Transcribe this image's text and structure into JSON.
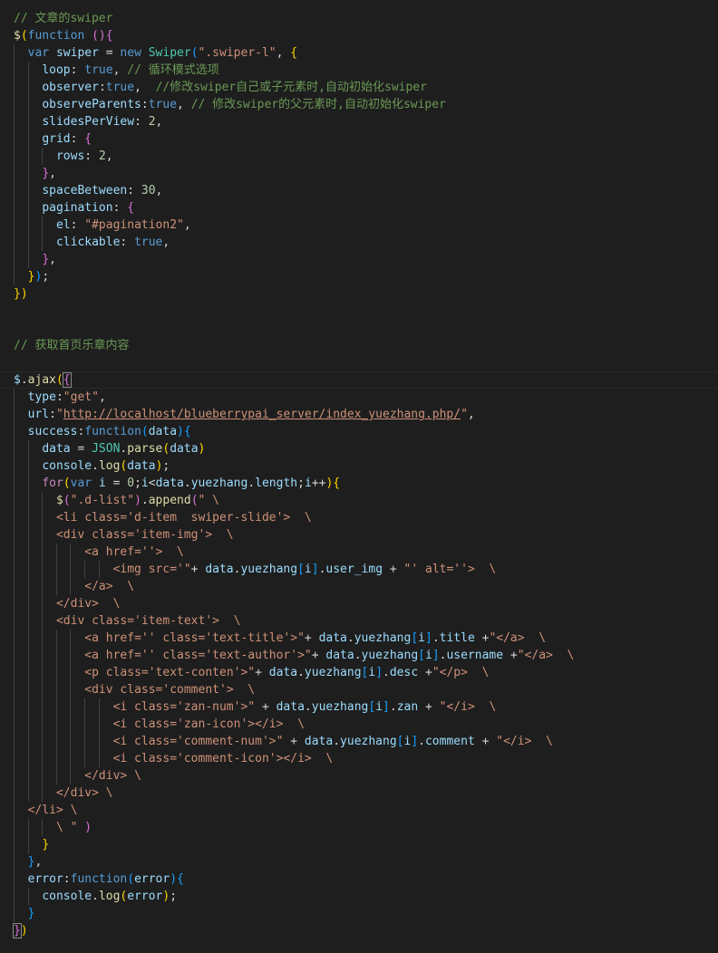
{
  "editor": {
    "theme": {
      "background": "#1e1e1e",
      "comment": "#6a9955",
      "keyword": "#569cd6",
      "variable": "#9cdcfe",
      "function": "#dcdcaa",
      "string": "#ce9178",
      "number": "#b5cea8",
      "class": "#4ec9b0",
      "bracket_colors": [
        "#ffd700",
        "#da70d6",
        "#179fff"
      ]
    },
    "lines": [
      {
        "indent": 0,
        "tokens": [
          [
            "cm",
            "// 文章的swiper"
          ]
        ]
      },
      {
        "indent": 0,
        "tokens": [
          [
            "fn",
            "$"
          ],
          [
            "b1",
            "("
          ],
          [
            "kw",
            "function"
          ],
          [
            "plain",
            " "
          ],
          [
            "b2",
            "()"
          ],
          [
            "b2",
            "{"
          ]
        ]
      },
      {
        "indent": 1,
        "tokens": [
          [
            "kw",
            "var"
          ],
          [
            "plain",
            " "
          ],
          [
            "var",
            "swiper"
          ],
          [
            "plain",
            " = "
          ],
          [
            "kw",
            "new"
          ],
          [
            "plain",
            " "
          ],
          [
            "cls",
            "Swiper"
          ],
          [
            "b3",
            "("
          ],
          [
            "str",
            "\".swiper-l\""
          ],
          [
            "plain",
            ", "
          ],
          [
            "b1",
            "{"
          ]
        ]
      },
      {
        "indent": 2,
        "tokens": [
          [
            "var",
            "loop"
          ],
          [
            "plain",
            ": "
          ],
          [
            "kw",
            "true"
          ],
          [
            "plain",
            ", "
          ],
          [
            "cm",
            "// 循环模式选项"
          ]
        ]
      },
      {
        "indent": 2,
        "tokens": [
          [
            "var",
            "observer"
          ],
          [
            "plain",
            ":"
          ],
          [
            "kw",
            "true"
          ],
          [
            "plain",
            ",  "
          ],
          [
            "cm",
            "//修改swiper自己或子元素时,自动初始化swiper"
          ]
        ]
      },
      {
        "indent": 2,
        "tokens": [
          [
            "var",
            "observeParents"
          ],
          [
            "plain",
            ":"
          ],
          [
            "kw",
            "true"
          ],
          [
            "plain",
            ", "
          ],
          [
            "cm",
            "// 修改swiper的父元素时,自动初始化swiper"
          ]
        ]
      },
      {
        "indent": 2,
        "tokens": [
          [
            "var",
            "slidesPerView"
          ],
          [
            "plain",
            ": "
          ],
          [
            "num",
            "2"
          ],
          [
            "plain",
            ","
          ]
        ]
      },
      {
        "indent": 2,
        "tokens": [
          [
            "var",
            "grid"
          ],
          [
            "plain",
            ": "
          ],
          [
            "b2",
            "{"
          ]
        ]
      },
      {
        "indent": 3,
        "tokens": [
          [
            "var",
            "rows"
          ],
          [
            "plain",
            ": "
          ],
          [
            "num",
            "2"
          ],
          [
            "plain",
            ","
          ]
        ]
      },
      {
        "indent": 2,
        "tokens": [
          [
            "b2",
            "}"
          ],
          [
            "plain",
            ","
          ]
        ]
      },
      {
        "indent": 2,
        "tokens": [
          [
            "var",
            "spaceBetween"
          ],
          [
            "plain",
            ": "
          ],
          [
            "num",
            "30"
          ],
          [
            "plain",
            ","
          ]
        ]
      },
      {
        "indent": 2,
        "tokens": [
          [
            "var",
            "pagination"
          ],
          [
            "plain",
            ": "
          ],
          [
            "b2",
            "{"
          ]
        ]
      },
      {
        "indent": 3,
        "tokens": [
          [
            "var",
            "el"
          ],
          [
            "plain",
            ": "
          ],
          [
            "str",
            "\"#pagination2\""
          ],
          [
            "plain",
            ","
          ]
        ]
      },
      {
        "indent": 3,
        "tokens": [
          [
            "var",
            "clickable"
          ],
          [
            "plain",
            ": "
          ],
          [
            "kw",
            "true"
          ],
          [
            "plain",
            ","
          ]
        ]
      },
      {
        "indent": 2,
        "tokens": [
          [
            "b2",
            "}"
          ],
          [
            "plain",
            ","
          ]
        ]
      },
      {
        "indent": 1,
        "tokens": [
          [
            "b1",
            "}"
          ],
          [
            "b3",
            ")"
          ],
          [
            "plain",
            ";"
          ]
        ]
      },
      {
        "indent": 0,
        "tokens": [
          [
            "b1",
            "})"
          ]
        ]
      },
      {
        "indent": 0,
        "tokens": []
      },
      {
        "indent": 0,
        "tokens": []
      },
      {
        "indent": 0,
        "tokens": [
          [
            "cm",
            "// 获取首页乐章内容"
          ]
        ]
      },
      {
        "indent": 0,
        "tokens": []
      },
      {
        "indent": 0,
        "current": true,
        "tokens": [
          [
            "var",
            "$"
          ],
          [
            "plain",
            "."
          ],
          [
            "fn",
            "ajax"
          ],
          [
            "b1",
            "("
          ],
          [
            "b2m",
            "{"
          ]
        ]
      },
      {
        "indent": 1,
        "tokens": [
          [
            "var",
            "type"
          ],
          [
            "plain",
            ":"
          ],
          [
            "str",
            "\"get\""
          ],
          [
            "plain",
            ","
          ]
        ]
      },
      {
        "indent": 1,
        "tokens": [
          [
            "var",
            "url"
          ],
          [
            "plain",
            ":"
          ],
          [
            "str",
            "\""
          ],
          [
            "url",
            "http://localhost/blueberrypai_server/index_yuezhang.php/"
          ],
          [
            "str",
            "\""
          ],
          [
            "plain",
            ","
          ]
        ]
      },
      {
        "indent": 1,
        "tokens": [
          [
            "var",
            "success"
          ],
          [
            "plain",
            ":"
          ],
          [
            "kw",
            "function"
          ],
          [
            "b3",
            "("
          ],
          [
            "var",
            "data"
          ],
          [
            "b3",
            ")"
          ],
          [
            "b3",
            "{"
          ]
        ]
      },
      {
        "indent": 2,
        "tokens": [
          [
            "var",
            "data"
          ],
          [
            "plain",
            " = "
          ],
          [
            "cls",
            "JSON"
          ],
          [
            "plain",
            "."
          ],
          [
            "fn",
            "parse"
          ],
          [
            "b1",
            "("
          ],
          [
            "var",
            "data"
          ],
          [
            "b1",
            ")"
          ]
        ]
      },
      {
        "indent": 2,
        "tokens": [
          [
            "var",
            "console"
          ],
          [
            "plain",
            "."
          ],
          [
            "fn",
            "log"
          ],
          [
            "b1",
            "("
          ],
          [
            "var",
            "data"
          ],
          [
            "b1",
            ")"
          ],
          [
            "plain",
            ";"
          ]
        ]
      },
      {
        "indent": 2,
        "tokens": [
          [
            "ctl",
            "for"
          ],
          [
            "b1",
            "("
          ],
          [
            "kw",
            "var"
          ],
          [
            "plain",
            " "
          ],
          [
            "var",
            "i"
          ],
          [
            "plain",
            " = "
          ],
          [
            "num",
            "0"
          ],
          [
            "plain",
            ";"
          ],
          [
            "var",
            "i"
          ],
          [
            "plain",
            "<"
          ],
          [
            "var",
            "data"
          ],
          [
            "plain",
            "."
          ],
          [
            "var",
            "yuezhang"
          ],
          [
            "plain",
            "."
          ],
          [
            "var",
            "length"
          ],
          [
            "plain",
            ";"
          ],
          [
            "var",
            "i"
          ],
          [
            "plain",
            "++"
          ],
          [
            "b1",
            ")"
          ],
          [
            "b1",
            "{"
          ]
        ]
      },
      {
        "indent": 3,
        "tokens": [
          [
            "fn",
            "$"
          ],
          [
            "b2",
            "("
          ],
          [
            "str",
            "\".d-list\""
          ],
          [
            "b2",
            ")"
          ],
          [
            "plain",
            "."
          ],
          [
            "fn",
            "append"
          ],
          [
            "b2",
            "("
          ],
          [
            "str",
            "\" \\"
          ]
        ]
      },
      {
        "indent": 3,
        "tokens": [
          [
            "str",
            "<li class='d-item  swiper-slide'>  \\"
          ]
        ]
      },
      {
        "indent": 3,
        "tokens": [
          [
            "str",
            "<div class='item-img'>  \\"
          ]
        ]
      },
      {
        "indent": 5,
        "tokens": [
          [
            "str",
            "<a href=''>  \\"
          ]
        ]
      },
      {
        "indent": 7,
        "tokens": [
          [
            "str",
            "<img src='\""
          ],
          [
            "plain",
            "+ "
          ],
          [
            "var",
            "data"
          ],
          [
            "plain",
            "."
          ],
          [
            "var",
            "yuezhang"
          ],
          [
            "b3",
            "["
          ],
          [
            "var",
            "i"
          ],
          [
            "b3",
            "]"
          ],
          [
            "plain",
            "."
          ],
          [
            "var",
            "user_img"
          ],
          [
            "plain",
            " + "
          ],
          [
            "str",
            "\"' alt=''>  \\"
          ]
        ]
      },
      {
        "indent": 5,
        "tokens": [
          [
            "str",
            "</a>  \\"
          ]
        ]
      },
      {
        "indent": 3,
        "tokens": [
          [
            "str",
            "</div>  \\"
          ]
        ]
      },
      {
        "indent": 3,
        "tokens": [
          [
            "str",
            "<div class='item-text'>  \\"
          ]
        ]
      },
      {
        "indent": 5,
        "tokens": [
          [
            "str",
            "<a href='' class='text-title'>\""
          ],
          [
            "plain",
            "+ "
          ],
          [
            "var",
            "data"
          ],
          [
            "plain",
            "."
          ],
          [
            "var",
            "yuezhang"
          ],
          [
            "b3",
            "["
          ],
          [
            "var",
            "i"
          ],
          [
            "b3",
            "]"
          ],
          [
            "plain",
            "."
          ],
          [
            "var",
            "title"
          ],
          [
            "plain",
            " +"
          ],
          [
            "str",
            "\"</a>  \\"
          ]
        ]
      },
      {
        "indent": 5,
        "tokens": [
          [
            "str",
            "<a href='' class='text-author'>\""
          ],
          [
            "plain",
            "+ "
          ],
          [
            "var",
            "data"
          ],
          [
            "plain",
            "."
          ],
          [
            "var",
            "yuezhang"
          ],
          [
            "b3",
            "["
          ],
          [
            "var",
            "i"
          ],
          [
            "b3",
            "]"
          ],
          [
            "plain",
            "."
          ],
          [
            "var",
            "username"
          ],
          [
            "plain",
            " +"
          ],
          [
            "str",
            "\"</a>  \\"
          ]
        ]
      },
      {
        "indent": 5,
        "tokens": [
          [
            "str",
            "<p class='text-conten'>\""
          ],
          [
            "plain",
            "+ "
          ],
          [
            "var",
            "data"
          ],
          [
            "plain",
            "."
          ],
          [
            "var",
            "yuezhang"
          ],
          [
            "b3",
            "["
          ],
          [
            "var",
            "i"
          ],
          [
            "b3",
            "]"
          ],
          [
            "plain",
            "."
          ],
          [
            "var",
            "desc"
          ],
          [
            "plain",
            " +"
          ],
          [
            "str",
            "\"</p>  \\"
          ]
        ]
      },
      {
        "indent": 5,
        "tokens": [
          [
            "str",
            "<div class='comment'>  \\"
          ]
        ]
      },
      {
        "indent": 7,
        "tokens": [
          [
            "str",
            "<i class='zan-num'>\""
          ],
          [
            "plain",
            " + "
          ],
          [
            "var",
            "data"
          ],
          [
            "plain",
            "."
          ],
          [
            "var",
            "yuezhang"
          ],
          [
            "b3",
            "["
          ],
          [
            "var",
            "i"
          ],
          [
            "b3",
            "]"
          ],
          [
            "plain",
            "."
          ],
          [
            "var",
            "zan"
          ],
          [
            "plain",
            " + "
          ],
          [
            "str",
            "\"</i>  \\"
          ]
        ]
      },
      {
        "indent": 7,
        "tokens": [
          [
            "str",
            "<i class='zan-icon'></i>  \\"
          ]
        ]
      },
      {
        "indent": 7,
        "tokens": [
          [
            "str",
            "<i class='comment-num'>\""
          ],
          [
            "plain",
            " + "
          ],
          [
            "var",
            "data"
          ],
          [
            "plain",
            "."
          ],
          [
            "var",
            "yuezhang"
          ],
          [
            "b3",
            "["
          ],
          [
            "var",
            "i"
          ],
          [
            "b3",
            "]"
          ],
          [
            "plain",
            "."
          ],
          [
            "var",
            "comment"
          ],
          [
            "plain",
            " + "
          ],
          [
            "str",
            "\"</i>  \\"
          ]
        ]
      },
      {
        "indent": 7,
        "tokens": [
          [
            "str",
            "<i class='comment-icon'></i>  \\"
          ]
        ]
      },
      {
        "indent": 5,
        "tokens": [
          [
            "str",
            "</div> \\"
          ]
        ]
      },
      {
        "indent": 3,
        "tokens": [
          [
            "str",
            "</div> \\"
          ]
        ]
      },
      {
        "indent": 1,
        "tokens": [
          [
            "str",
            "</li> \\"
          ]
        ]
      },
      {
        "indent": 3,
        "tokens": [
          [
            "str",
            "\\ \" "
          ],
          [
            "b2",
            ")"
          ]
        ]
      },
      {
        "indent": 2,
        "tokens": [
          [
            "b1",
            "}"
          ]
        ]
      },
      {
        "indent": 1,
        "tokens": [
          [
            "b3",
            "}"
          ],
          [
            "plain",
            ","
          ]
        ]
      },
      {
        "indent": 1,
        "tokens": [
          [
            "var",
            "error"
          ],
          [
            "plain",
            ":"
          ],
          [
            "kw",
            "function"
          ],
          [
            "b3",
            "("
          ],
          [
            "var",
            "error"
          ],
          [
            "b3",
            ")"
          ],
          [
            "b3",
            "{"
          ]
        ]
      },
      {
        "indent": 2,
        "tokens": [
          [
            "var",
            "console"
          ],
          [
            "plain",
            "."
          ],
          [
            "fn",
            "log"
          ],
          [
            "b1",
            "("
          ],
          [
            "var",
            "error"
          ],
          [
            "b1",
            ")"
          ],
          [
            "plain",
            ";"
          ]
        ]
      },
      {
        "indent": 1,
        "tokens": [
          [
            "b3",
            "}"
          ]
        ]
      },
      {
        "indent": 0,
        "tokens": [
          [
            "b2m",
            "}"
          ],
          [
            "b1",
            ")"
          ]
        ]
      }
    ]
  }
}
